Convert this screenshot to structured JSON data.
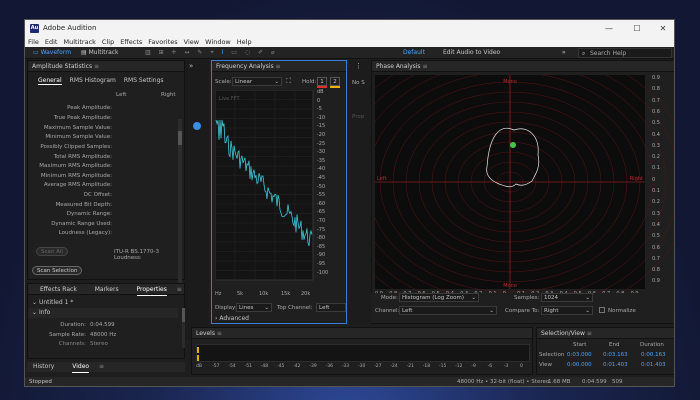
{
  "app": {
    "title": "Adobe Audition",
    "logo": "Au"
  },
  "window_controls": [
    "—",
    "☐",
    "✕"
  ],
  "menu": [
    "File",
    "Edit",
    "Multitrack",
    "Clip",
    "Effects",
    "Favorites",
    "View",
    "Window",
    "Help"
  ],
  "toolbar": {
    "waveform": "Waveform",
    "multitrack": "Multitrack",
    "workspace_default": "Default",
    "workspace_edit": "Edit Audio to Video",
    "search_placeholder": "Search Help"
  },
  "amplitude": {
    "title": "Amplitude Statistics",
    "tabs": [
      "General",
      "RMS Histogram",
      "RMS Settings"
    ],
    "col_left": "Left",
    "col_right": "Right",
    "rows": [
      "Peak Amplitude:",
      "True Peak Amplitude:",
      "Maximum Sample Value:",
      "Minimum Sample Value:",
      "Possibly Clipped Samples:",
      "Total RMS Amplitude:",
      "Maximum RMS Amplitude:",
      "Minimum RMS Amplitude:",
      "Average RMS Amplitude:",
      "DC Offset:",
      "Measured Bit Depth:",
      "Dynamic Range:",
      "Dynamic Range Used:",
      "Loudness (Legacy):"
    ],
    "scan_all": "Scan All",
    "itu": "ITU-R BS.1770-3 Loudness:",
    "scan_selection": "Scan Selection"
  },
  "properties": {
    "tabs": [
      "Effects Rack",
      "Markers",
      "Properties"
    ],
    "file": "Untitled 1 *",
    "info": "Info",
    "duration_label": "Duration:",
    "duration": "0:04.599",
    "sample_rate_label": "Sample Rate:",
    "sample_rate": "48000 Hz",
    "channels_label": "Channels:",
    "channels": "Stereo"
  },
  "bottom_tabs": {
    "history": "History",
    "video": "Video"
  },
  "status_left": "Stopped",
  "freq": {
    "title": "Frequency Analysis",
    "scale_label": "Scale:",
    "scale": "Linear",
    "hold_label": "Hold:",
    "hold1": "1",
    "hold2": "2",
    "live_label": "Live FFT",
    "db_ticks": [
      "dB",
      "0",
      "-5",
      "-10",
      "-15",
      "-20",
      "-25",
      "-30",
      "-35",
      "-40",
      "-45",
      "-50",
      "-55",
      "-60",
      "-65",
      "-70",
      "-75",
      "-80",
      "-85",
      "-90",
      "-95",
      "-100"
    ],
    "hz_ticks": [
      "Hz",
      "5k",
      "10k",
      "15k",
      "20k"
    ],
    "display_label": "Display:",
    "display": "Lines",
    "top_channel_label": "Top Channel:",
    "top_channel": "Left",
    "advanced": "Advanced",
    "accent": "#3ec7d6"
  },
  "phase": {
    "title": "Phase Analysis",
    "label_top": "Mono",
    "label_bottom": "Mono",
    "label_left": "Left",
    "label_right": "Right",
    "right_ticks": [
      "0.9",
      "0.8",
      "0.7",
      "0.6",
      "0.5",
      "0.4",
      "0.3",
      "0.2",
      "0.1",
      "0",
      "0.1",
      "0.2",
      "0.3",
      "0.4",
      "0.5",
      "0.6",
      "0.7",
      "0.8",
      "0.9"
    ],
    "bottom_ticks": [
      "0.9",
      "0.8",
      "0.7",
      "0.6",
      "0.5",
      "0.4",
      "0.3",
      "0.2",
      "0.1",
      "0",
      "0.1",
      "0.2",
      "0.3",
      "0.4",
      "0.5",
      "0.6",
      "0.7",
      "0.8",
      "0.9"
    ],
    "mode_label": "Mode:",
    "mode": "Histogram (Log Zoom)",
    "samples_label": "Samples:",
    "samples": "1024",
    "channel_label": "Channel:",
    "channel": "Left",
    "compare_label": "Compare To:",
    "compare": "Right",
    "normalize": "Normalize"
  },
  "levels": {
    "title": "Levels",
    "ticks": [
      "dB",
      "-57",
      "-54",
      "-51",
      "-48",
      "-45",
      "-42",
      "-39",
      "-36",
      "-33",
      "-30",
      "-27",
      "-24",
      "-21",
      "-18",
      "-15",
      "-12",
      "-9",
      "-6",
      "-3",
      "0"
    ]
  },
  "selection": {
    "title": "Selection/View",
    "headers": [
      "Start",
      "End",
      "Duration"
    ],
    "rows": [
      {
        "label": "Selection",
        "start": "0:03.000",
        "end": "0:03.163",
        "duration": "0:00.163"
      },
      {
        "label": "View",
        "start": "0:00.000",
        "end": "0:01.403",
        "duration": "0:01.403"
      }
    ]
  },
  "statusbar": {
    "format": "48000 Hz • 32-bit (float) • Stereo",
    "size": "1.68 MB",
    "time": "0:04.599",
    "extra": "509"
  },
  "no_signal": "No S",
  "prop_fragment": "Prop"
}
